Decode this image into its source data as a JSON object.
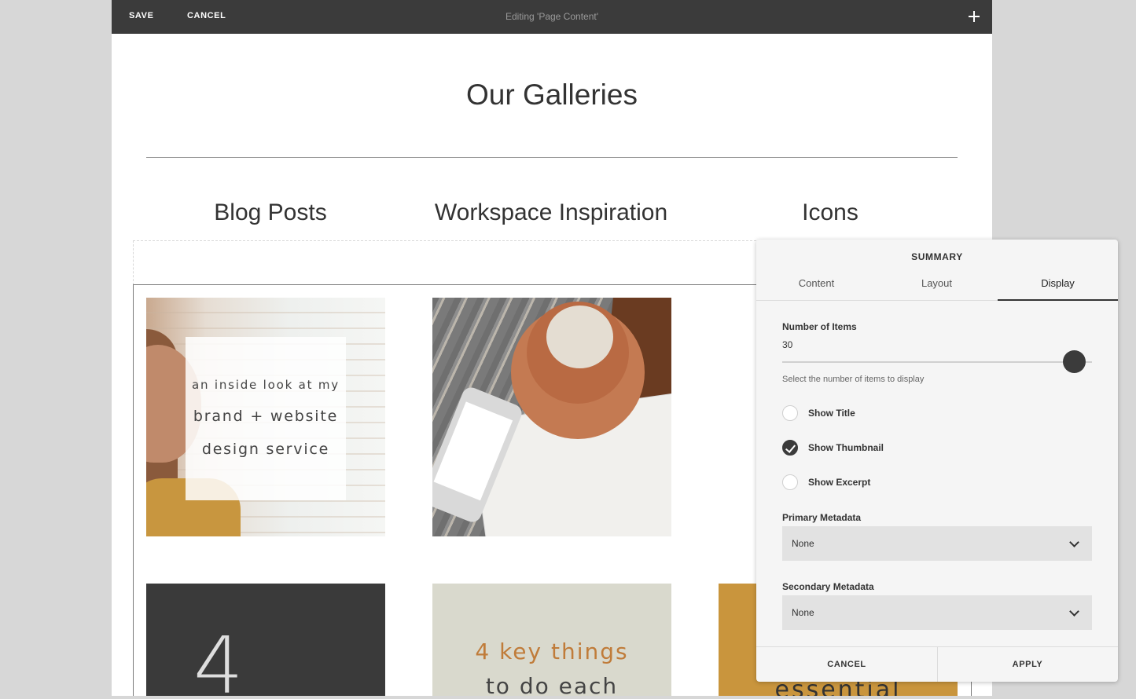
{
  "toolbar": {
    "save_label": "SAVE",
    "cancel_label": "CANCEL",
    "status": "Editing 'Page Content'",
    "add_icon": "plus-icon"
  },
  "page": {
    "title": "Our Galleries",
    "columns": [
      "Blog Posts",
      "Workspace Inspiration",
      "Icons"
    ]
  },
  "thumbnails": {
    "blog_1": [
      "an inside look at my",
      "brand + website",
      "design service"
    ],
    "row2_blog": "4",
    "row2_workspace": [
      "4 key things",
      "to do each"
    ],
    "row2_icons": "essential"
  },
  "summary_panel": {
    "title": "SUMMARY",
    "tabs": [
      "Content",
      "Layout",
      "Display"
    ],
    "active_tab": "Display",
    "number_of_items": {
      "label": "Number of Items",
      "value": "30",
      "help": "Select the number of items to display",
      "slider_fraction": 0.95
    },
    "options": [
      {
        "label": "Show Title",
        "checked": false
      },
      {
        "label": "Show Thumbnail",
        "checked": true
      },
      {
        "label": "Show Excerpt",
        "checked": false
      }
    ],
    "primary_metadata": {
      "label": "Primary Metadata",
      "value": "None"
    },
    "secondary_metadata": {
      "label": "Secondary Metadata",
      "value": "None"
    },
    "cancel_label": "CANCEL",
    "apply_label": "APPLY"
  }
}
